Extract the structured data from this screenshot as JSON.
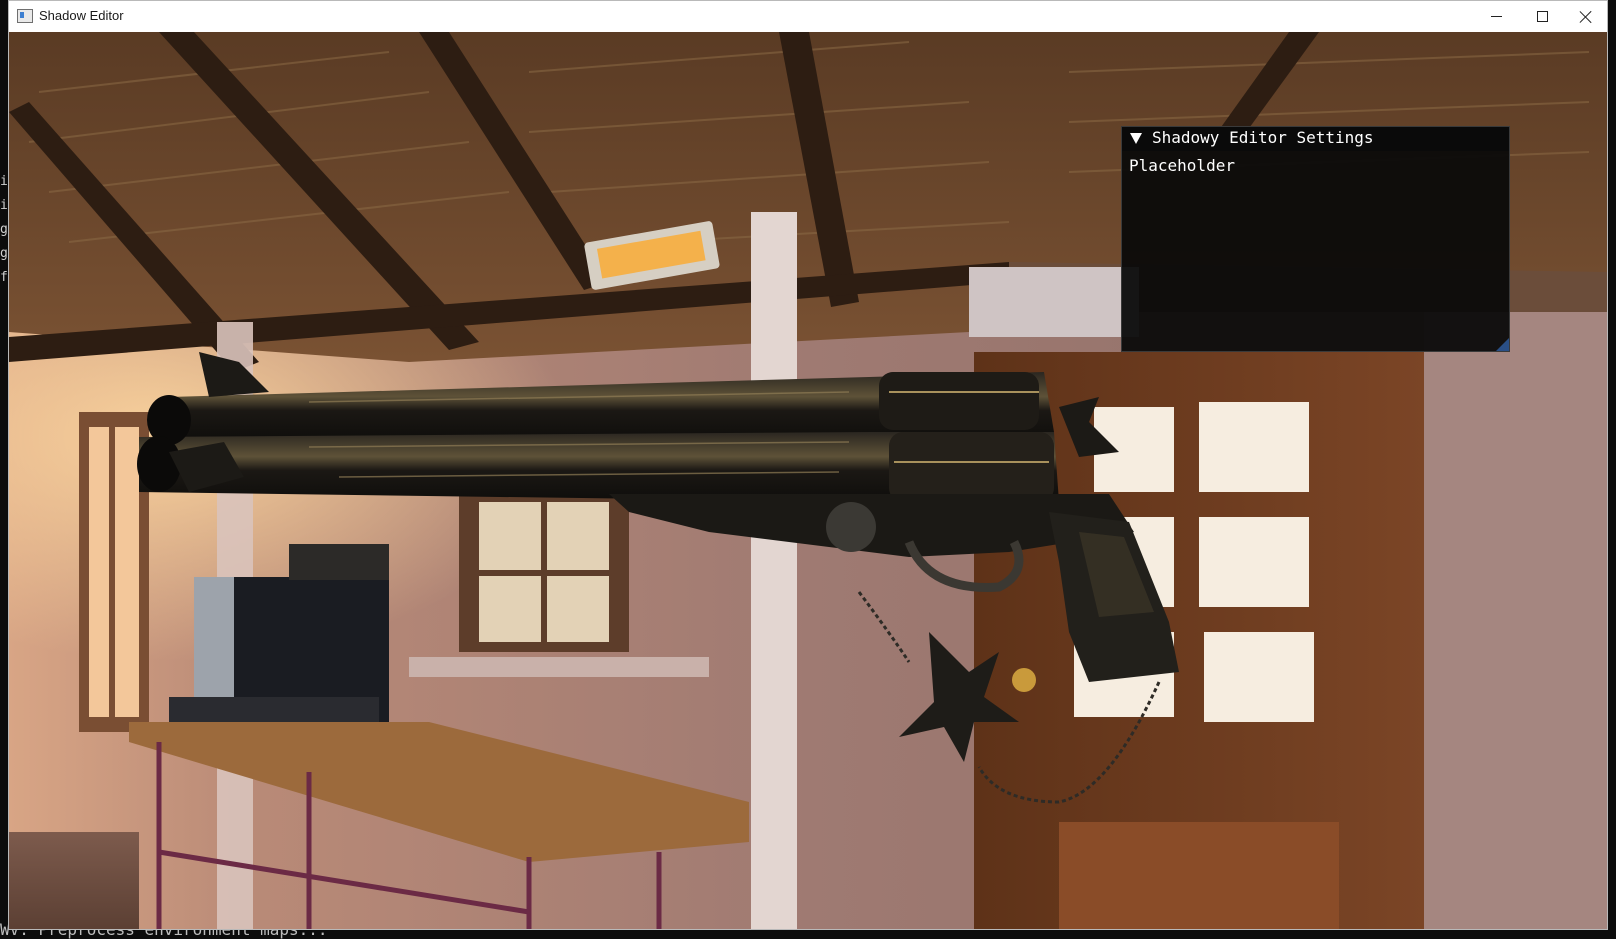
{
  "window": {
    "title": "Shadow Editor"
  },
  "title_buttons": {
    "minimize_icon": "minimize-icon",
    "maximize_icon": "maximize-icon",
    "close_icon": "close-icon"
  },
  "settings_panel": {
    "title": "Shadowy Editor Settings",
    "collapse_icon": "triangle-down-icon",
    "body_text": "Placeholder"
  },
  "console": {
    "side_fragments": [
      "i",
      "i",
      "g",
      "g",
      "f"
    ],
    "bottom_line": "WV: Preprocess environment maps..."
  },
  "colors": {
    "panel_background": "#0a0a0a",
    "resize_grip": "#2a4f86",
    "titlebar": "#ffffff"
  }
}
